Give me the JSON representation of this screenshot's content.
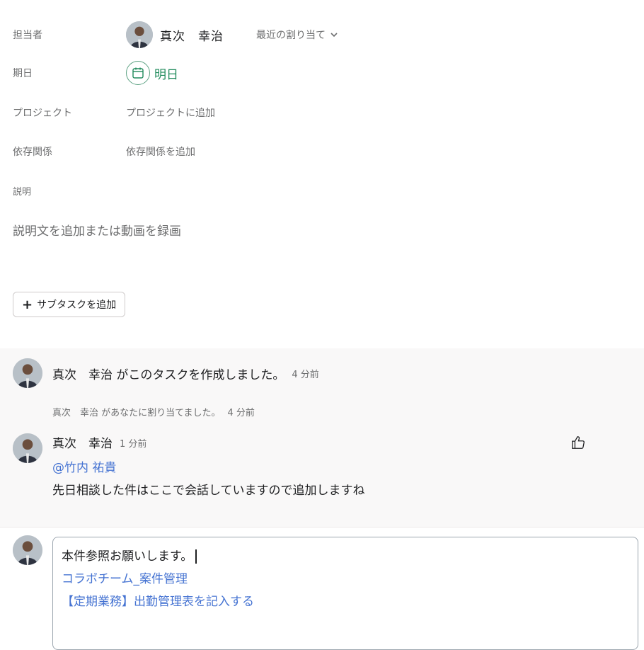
{
  "fields": {
    "assignee_label": "担当者",
    "assignee_name": "真次　幸治",
    "recent_assign": "最近の割り当て",
    "due_label": "期日",
    "due_value": "明日",
    "project_label": "プロジェクト",
    "project_value": "プロジェクトに追加",
    "deps_label": "依存関係",
    "deps_value": "依存関係を追加"
  },
  "description": {
    "label": "説明",
    "placeholder": "説明文を追加または動画を録画"
  },
  "subtask": {
    "plus": "+",
    "label": "サブタスクを追加"
  },
  "activity": {
    "created": {
      "text": "真次　幸治 がこのタスクを作成しました。",
      "time": "4 分前"
    },
    "assigned": {
      "text": "真次　幸治 があなたに割り当てました。",
      "time": "4 分前"
    },
    "comment": {
      "author": "真次　幸治",
      "time": "1 分前",
      "mention": "@竹内 祐貴",
      "body": "先日相談した件はここで会話していますので追加しますね"
    }
  },
  "composer": {
    "line1": "本件参照お願いします。",
    "line2": "コラボチーム_案件管理",
    "line3": "【定期業務】出勤管理表を記入する"
  },
  "colors": {
    "accent_green": "#1f8a5b",
    "link_blue": "#4573d2",
    "activity_bg": "#f9f8f8"
  }
}
